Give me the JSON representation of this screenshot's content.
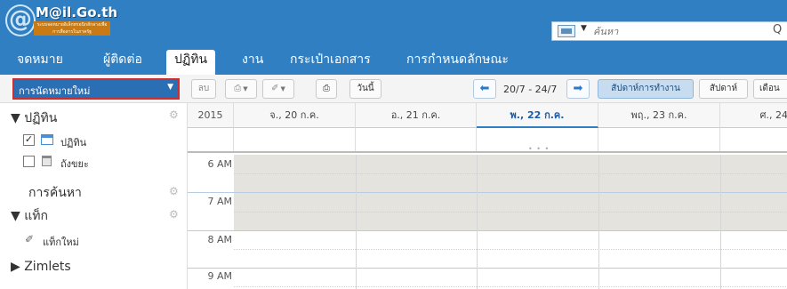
{
  "header": {
    "logo_symbol": "@",
    "logo_name": "M@il.Go.th",
    "logo_tagline": "ระบบจดหมายอิเล็กทรอนิกส์กลางเพื่อการสื่อสารในภาครัฐ",
    "search_placeholder": "ค้นหา",
    "search_type_icon": "calendar-icon",
    "search_icon": "search-icon",
    "colors": {
      "bar": "#2f7fc2",
      "text": "#ffffff"
    }
  },
  "tabs": [
    {
      "label": "จดหมาย",
      "active": false
    },
    {
      "label": "ผู้ติดต่อ",
      "active": false
    },
    {
      "label": "ปฏิทิน",
      "active": true
    },
    {
      "label": "งาน",
      "active": false
    },
    {
      "label": "กระเป๋าเอกสาร",
      "active": false
    },
    {
      "label": "การกำหนดลักษณะ",
      "active": false
    }
  ],
  "toolbar": {
    "new_appointment": "การนัดหมายใหม่",
    "delete": "ลบ",
    "print_icon": "printer-icon",
    "today": "วันนี้",
    "date_range": "20/7 - 24/7",
    "work_week": "สัปดาห์การทำงาน",
    "week": "สัปดาห์",
    "month": "เดือน",
    "highlight_color": "#d12c2c"
  },
  "sidebar": {
    "calendar_section": "ปฏิทิน",
    "items": [
      {
        "label": "ปฏิทิน",
        "checked": true,
        "icon": "calendar-icon"
      },
      {
        "label": "ถังขยะ",
        "checked": false,
        "icon": "trash-icon"
      }
    ],
    "search_section": "การค้นหา",
    "tags_section": "แท็ก",
    "new_tag": "แท็กใหม่",
    "zimlets": "Zimlets"
  },
  "calendar": {
    "year": "2015",
    "days": [
      {
        "label": "จ., 20 ก.ค.",
        "today": false
      },
      {
        "label": "อ., 21 ก.ค.",
        "today": false
      },
      {
        "label": "พ., 22 ก.ค.",
        "today": true
      },
      {
        "label": "พฤ., 23 ก.ค.",
        "today": false
      },
      {
        "label": "ศ., 24",
        "today": false
      }
    ],
    "times": [
      "6 AM",
      "7 AM",
      "8 AM",
      "9 AM"
    ]
  }
}
